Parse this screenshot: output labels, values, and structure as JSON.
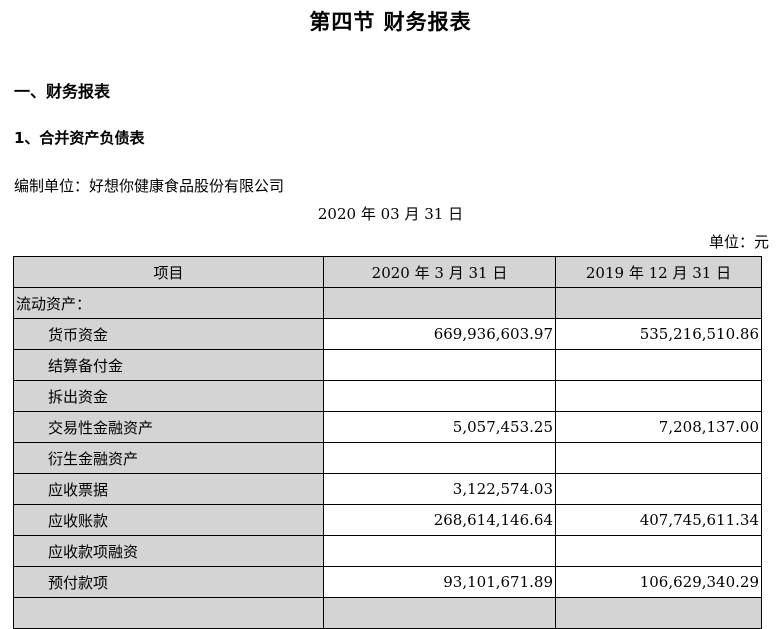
{
  "section_title": "第四节  财务报表",
  "heading1": "一、财务报表",
  "heading2": "1、合并资产负债表",
  "compiler": "编制单位：好想你健康食品股份有限公司",
  "report_date": "2020 年 03 月 31 日",
  "unit": "单位：元",
  "table": {
    "headers": [
      "项目",
      "2020 年 3 月 31 日",
      "2019 年 12 月 31 日"
    ],
    "rows": [
      {
        "item": "流动资产：",
        "cur": "",
        "prev": ""
      },
      {
        "item": "货币资金",
        "cur": "669,936,603.97",
        "prev": "535,216,510.86"
      },
      {
        "item": "结算备付金",
        "cur": "",
        "prev": ""
      },
      {
        "item": "拆出资金",
        "cur": "",
        "prev": ""
      },
      {
        "item": "交易性金融资产",
        "cur": "5,057,453.25",
        "prev": "7,208,137.00"
      },
      {
        "item": "衍生金融资产",
        "cur": "",
        "prev": ""
      },
      {
        "item": "应收票据",
        "cur": "3,122,574.03",
        "prev": ""
      },
      {
        "item": "应收账款",
        "cur": "268,614,146.64",
        "prev": "407,745,611.34"
      },
      {
        "item": "应收款项融资",
        "cur": "",
        "prev": ""
      },
      {
        "item": "预付款项",
        "cur": "93,101,671.89",
        "prev": "106,629,340.29"
      },
      {
        "item": "",
        "cur": "",
        "prev": ""
      }
    ]
  }
}
